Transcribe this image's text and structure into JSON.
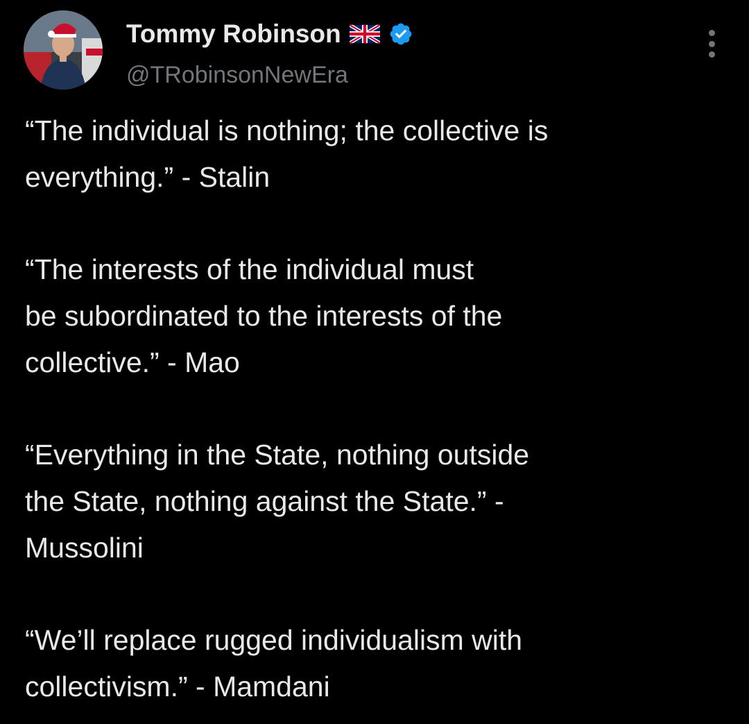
{
  "author": {
    "display_name": "Tommy Robinson",
    "handle": "@TRobinsonNewEra",
    "flag_icon": "uk-flag-icon",
    "verified_icon": "verified-badge-icon",
    "verified_color": "#1d9bf0"
  },
  "more_icon": "more-vertical-icon",
  "tweet": {
    "paragraphs": [
      "“The individual is nothing; the collective is\neverything.” - Stalin",
      "“The interests of the individual must\nbe subordinated to the interests of the\ncollective.” - Mao",
      "“Everything in the State, nothing outside\nthe State, nothing against the State.” -\nMussolini",
      "“We’ll replace rugged individualism with\ncollectivism.” - Mamdani"
    ]
  },
  "colors": {
    "background": "#000000",
    "text_primary": "#e7e9ea",
    "text_secondary": "#71767b"
  }
}
